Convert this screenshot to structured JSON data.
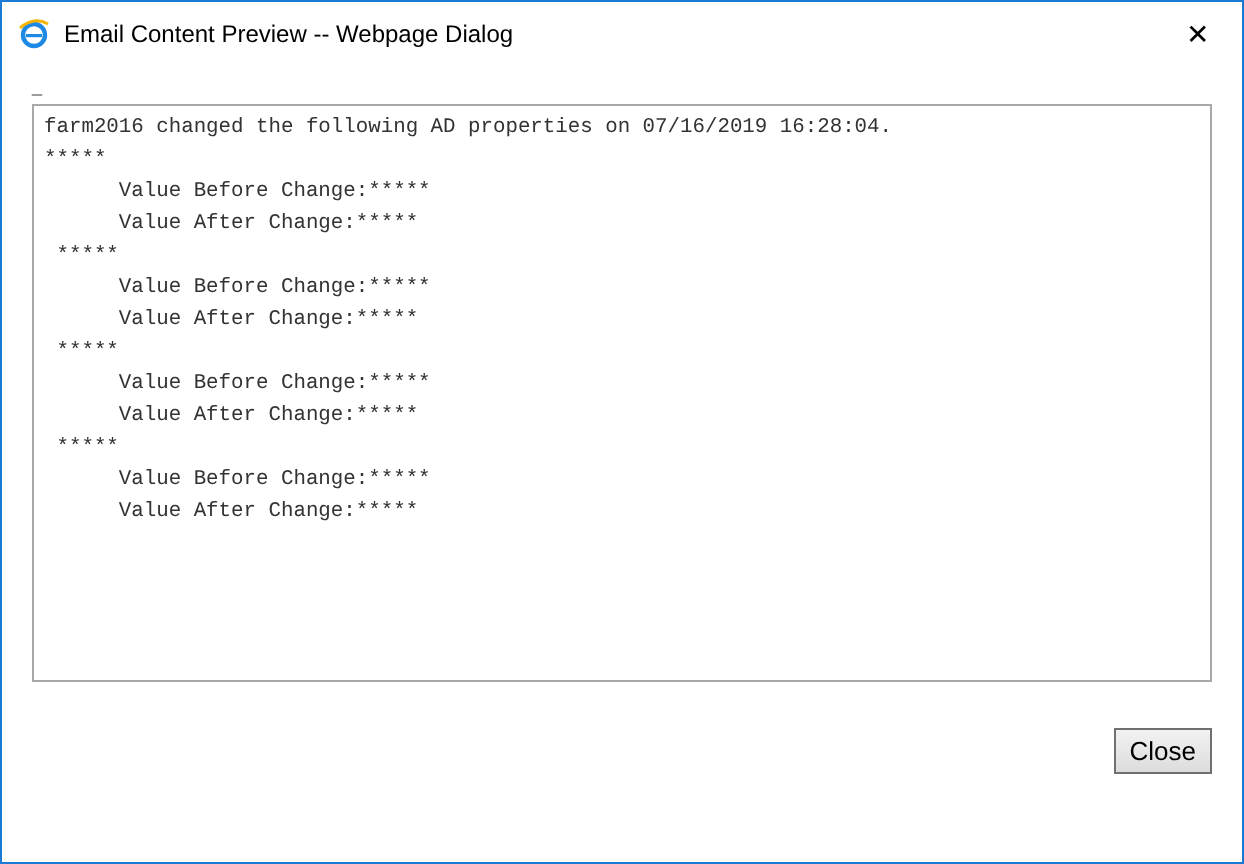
{
  "window": {
    "title": "Email Content Preview -- Webpage Dialog",
    "close_glyph": "✕"
  },
  "marker": "_",
  "content": {
    "lines": [
      "farm2016 changed the following AD properties on 07/16/2019 16:28:04.",
      "*****",
      "      Value Before Change:*****",
      "      Value After Change:*****",
      " *****",
      "      Value Before Change:*****",
      "      Value After Change:*****",
      " *****",
      "      Value Before Change:*****",
      "      Value After Change:*****",
      " *****",
      "      Value Before Change:*****",
      "      Value After Change:*****"
    ]
  },
  "buttons": [
    {
      "label": "Close"
    }
  ]
}
